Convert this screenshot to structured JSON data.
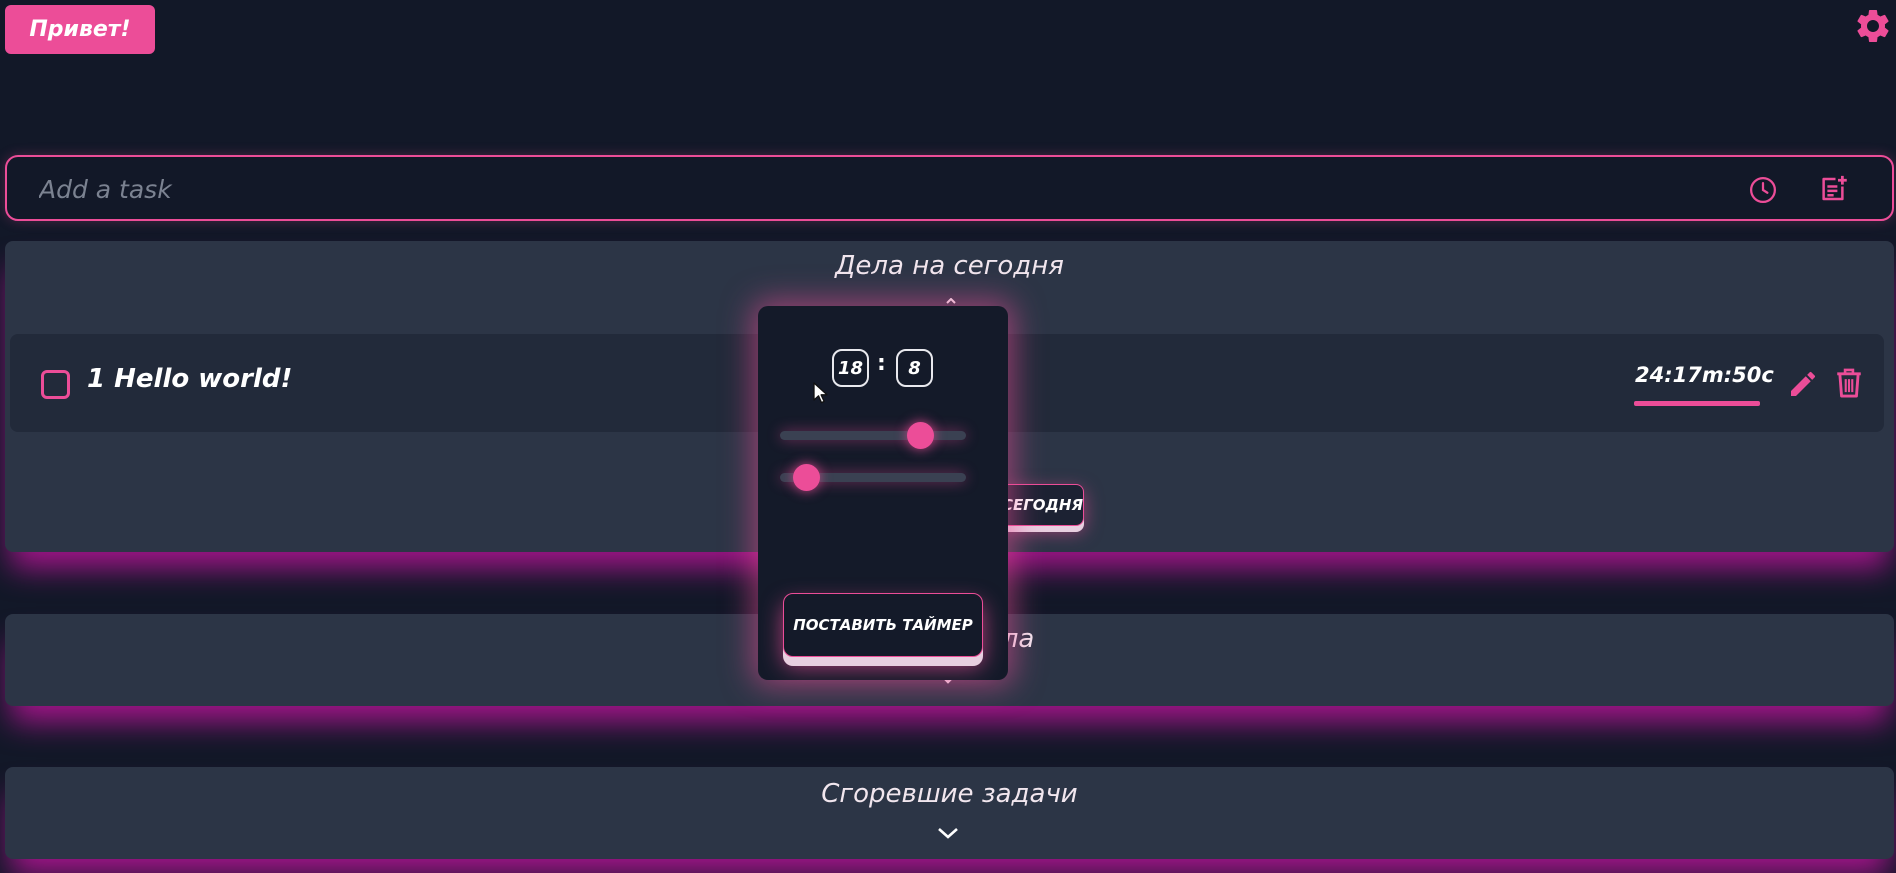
{
  "header": {
    "greet_label": "Привет!"
  },
  "task_input": {
    "placeholder": "Add a task"
  },
  "sections": {
    "today": {
      "title": "Дела на сегодня",
      "tasks": [
        {
          "label": "1 Hello world!",
          "timer": "24:17m:50c",
          "checked": false
        }
      ],
      "today_button": "СЕГОДНЯ"
    },
    "done": {
      "title_visible_part": "дела"
    },
    "burned": {
      "title": "Сгоревшие задачи"
    }
  },
  "timer_popup": {
    "hours": "18",
    "minutes": "8",
    "separator": ":",
    "hours_slider_fraction": 0.75,
    "minutes_slider_fraction": 0.14,
    "set_button": "ПОСТАВИТЬ ТАЙМЕР"
  },
  "colors": {
    "accent": "#ec4d98",
    "background": "#121828",
    "panel": "#2c3546",
    "row": "#222a3a",
    "glow": "#d214aa"
  }
}
